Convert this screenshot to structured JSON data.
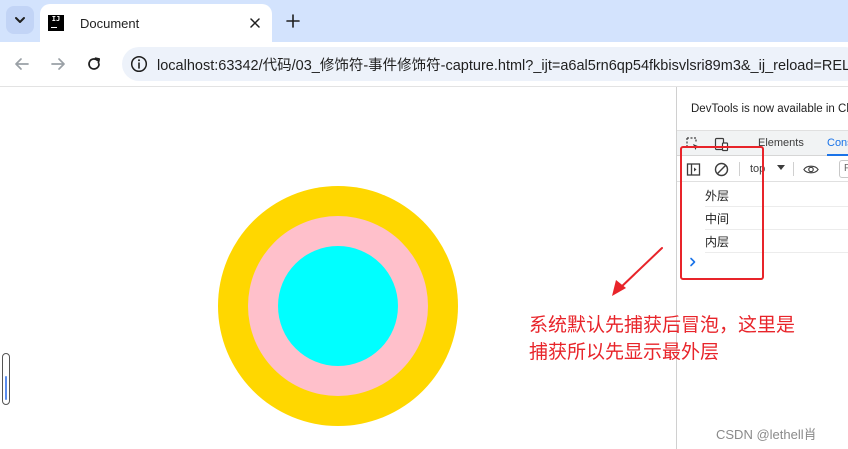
{
  "browser": {
    "tab": {
      "favicon_text": "IJ",
      "title": "Document"
    },
    "address_bar": {
      "url": "localhost:63342/代码/03_修饰符-事件修饰符-capture.html?_ijt=a6al5rn6qp54fkbisvlsri89m3&_ij_reload=RELOAD_ON_SAVE"
    }
  },
  "page": {
    "circles": {
      "outer_color": "#ffd700",
      "middle_color": "#ffc0cb",
      "inner_color": "#00ffff"
    }
  },
  "devtools": {
    "banner": "DevTools is now available in Chinese!",
    "tabs": [
      {
        "label": "Elements"
      },
      {
        "label": "Console"
      }
    ],
    "console_bar": {
      "context": "top",
      "filter_placeholder": "Filter"
    },
    "logs": [
      "外层",
      "中间",
      "内层"
    ]
  },
  "annotation": {
    "text_line1": "系统默认先捕获后冒泡，这里是",
    "text_line2": "捕获所以先显示最外层",
    "color": "#e8242a"
  },
  "watermark": "CSDN @lethell肖",
  "icons": {
    "tab_search": "chevron-down-icon",
    "close": "close-icon",
    "new_tab": "plus-icon",
    "back": "back-arrow-icon",
    "forward": "forward-arrow-icon",
    "reload": "reload-icon",
    "site_info": "info-icon"
  }
}
